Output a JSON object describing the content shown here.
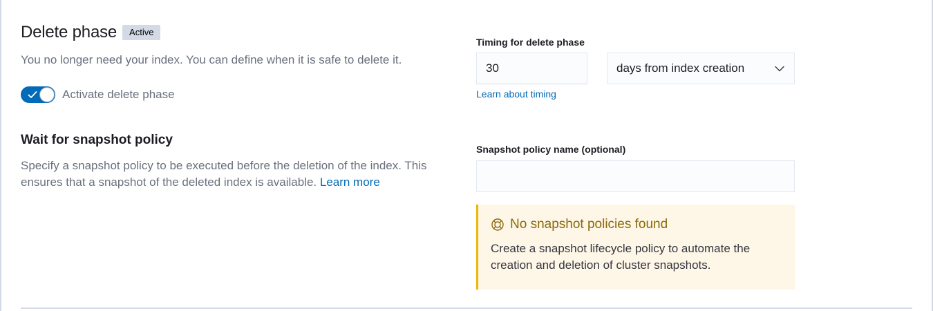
{
  "phase": {
    "title": "Delete phase",
    "badge": "Active",
    "description": "You no longer need your index. You can define when it is safe to delete it.",
    "toggle_label": "Activate delete phase",
    "toggle_on": true
  },
  "snapshot_section": {
    "title": "Wait for snapshot policy",
    "description": "Specify a snapshot policy to be executed before the deletion of the index. This ensures that a snapshot of the deleted index is available.",
    "learn_more": "Learn more"
  },
  "timing": {
    "label": "Timing for delete phase",
    "value": "30",
    "unit_selected": "days from index creation",
    "learn_link": "Learn about timing"
  },
  "snapshot_policy": {
    "label": "Snapshot policy name (optional)",
    "value": "",
    "placeholder": ""
  },
  "callout": {
    "icon": "help-icon",
    "title": "No snapshot policies found",
    "body": "Create a snapshot lifecycle policy to automate the creation and deletion of cluster snapshots."
  },
  "colors": {
    "primary": "#006bb8",
    "warning_bg": "#fef6e6",
    "warning_border": "#ecb602",
    "warning_text": "#8a6a0a"
  }
}
